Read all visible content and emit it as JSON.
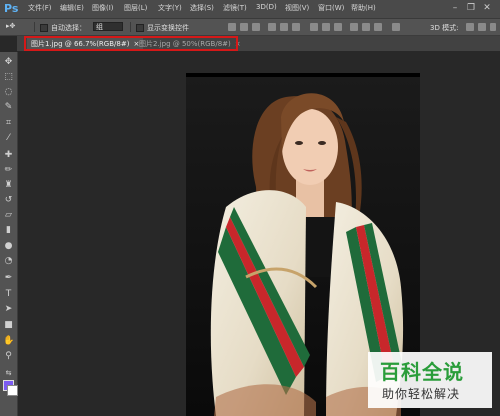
{
  "app": {
    "logo": "Ps"
  },
  "menu": [
    {
      "label": "文件(F)"
    },
    {
      "label": "编辑(E)"
    },
    {
      "label": "图像(I)"
    },
    {
      "label": "图层(L)"
    },
    {
      "label": "文字(Y)"
    },
    {
      "label": "选择(S)"
    },
    {
      "label": "滤镜(T)"
    },
    {
      "label": "3D(D)"
    },
    {
      "label": "视图(V)"
    },
    {
      "label": "窗口(W)"
    },
    {
      "label": "帮助(H)"
    }
  ],
  "window_controls": {
    "minimize": "–",
    "restore": "❐",
    "close": "✕"
  },
  "options": {
    "auto_select_label": "自动选择：",
    "auto_select_value": "组",
    "show_transform_label": "显示变换控件",
    "mode_3d_label": "3D 模式:"
  },
  "tabs": [
    {
      "label": "图片1.jpg @ 66.7%(RGB/8#)",
      "close": "×",
      "active": true
    },
    {
      "label": "图片2.jpg @ 50%(RGB/8#)",
      "close": "×",
      "active": false
    }
  ],
  "tools": [
    "move-icon",
    "marquee-icon",
    "lasso-icon",
    "quick-select-icon",
    "crop-icon",
    "eyedropper-icon",
    "healing-icon",
    "brush-icon",
    "stamp-icon",
    "history-brush-icon",
    "eraser-icon",
    "gradient-icon",
    "blur-icon",
    "dodge-icon",
    "pen-icon",
    "type-icon",
    "path-select-icon",
    "shape-icon",
    "hand-icon",
    "zoom-icon"
  ],
  "colors": {
    "foreground": "#7b5bf2",
    "background": "#ffffff",
    "highlight": "#d51818"
  },
  "watermark": {
    "top": "百科全说",
    "bottom": "助你轻松解决"
  }
}
